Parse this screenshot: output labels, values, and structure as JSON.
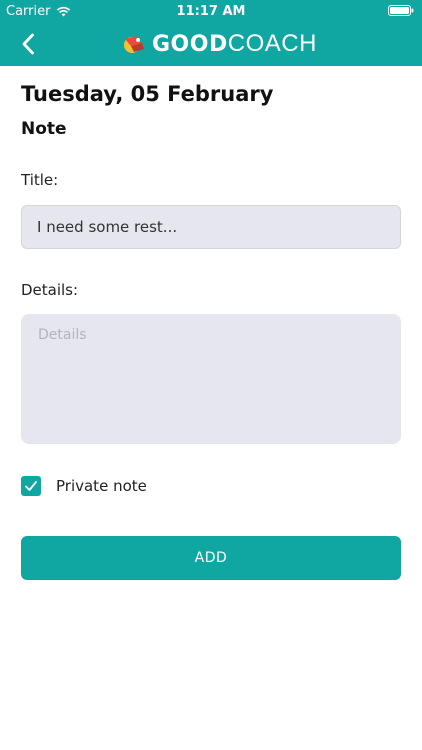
{
  "status_bar": {
    "carrier": "Carrier",
    "time": "11:17 AM"
  },
  "nav": {
    "logo_bold": "GOOD",
    "logo_light": "COACH"
  },
  "page": {
    "date_heading": "Tuesday, 05 February",
    "section_heading": "Note"
  },
  "form": {
    "title_label": "Title:",
    "title_value": "I need some rest...",
    "details_label": "Details:",
    "details_placeholder": "Details",
    "private_label": "Private note",
    "private_checked": true,
    "add_label": "ADD"
  },
  "colors": {
    "accent": "#10a7a2",
    "input_bg": "#e6e6ee"
  },
  "icons": [
    "wifi-icon",
    "battery-icon",
    "back-chevron-icon",
    "logo-icon",
    "checkmark-icon"
  ]
}
